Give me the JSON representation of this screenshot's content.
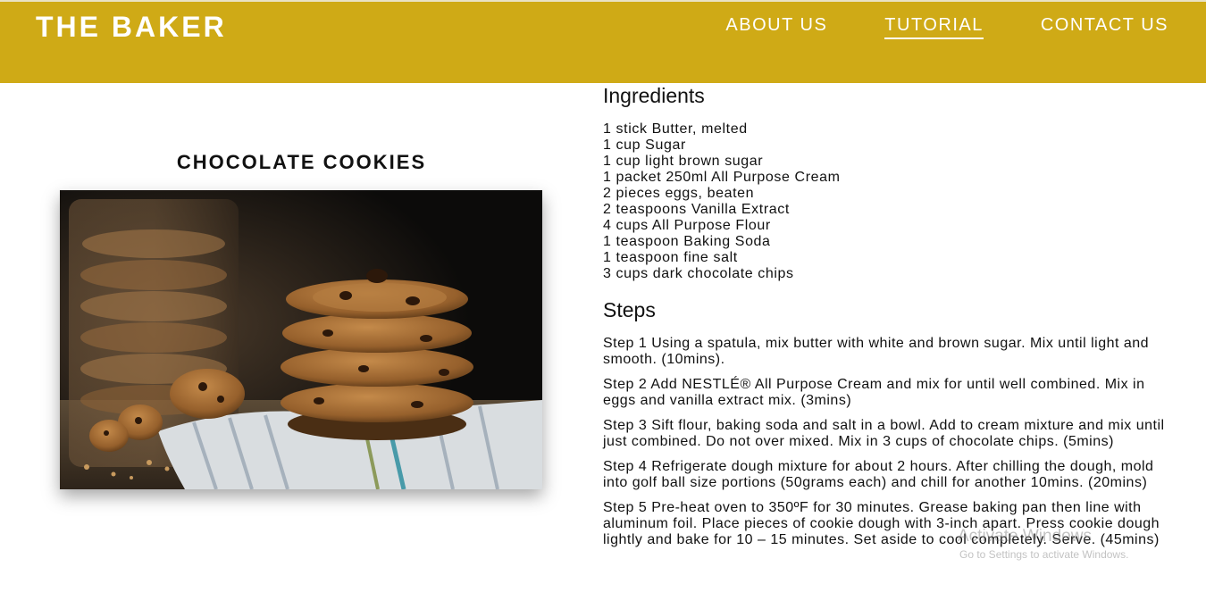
{
  "header": {
    "brand": "THE BAKER",
    "nav": [
      {
        "label": "ABOUT US",
        "active": false
      },
      {
        "label": "TUTORIAL",
        "active": true
      },
      {
        "label": "CONTACT US",
        "active": false
      }
    ],
    "bar_color": "#cfaa16"
  },
  "recipe": {
    "title": "CHOCOLATE COOKIES",
    "image_icon": "cookies-photo"
  },
  "ingredients": {
    "heading": "Ingredients",
    "items": [
      "1 stick Butter, melted",
      "1 cup Sugar",
      "1 cup light brown sugar",
      "1 packet 250ml All Purpose Cream",
      "2 pieces eggs, beaten",
      "2 teaspoons Vanilla Extract",
      "4 cups All Purpose Flour",
      "1 teaspoon Baking Soda",
      "1 teaspoon fine salt",
      "3 cups dark chocolate chips"
    ]
  },
  "steps": {
    "heading": "Steps",
    "items": [
      "Step 1 Using a spatula, mix butter with white and brown sugar. Mix until light and smooth. (10mins).",
      "Step 2 Add NESTLÉ® All Purpose Cream and mix for until well combined. Mix in eggs and vanilla extract mix. (3mins)",
      "Step 3 Sift flour, baking soda and salt in a bowl. Add to cream mixture and mix until just combined. Do not over mixed. Mix in 3 cups of chocolate chips. (5mins)",
      "Step 4 Refrigerate dough mixture for about 2 hours. After chilling the dough, mold into golf ball size portions (50grams each) and chill for another 10mins. (20mins)",
      "Step 5 Pre-heat oven to 350ºF for 30 minutes. Grease baking pan then line with aluminum foil. Place pieces of cookie dough with 3-inch apart. Press cookie dough lightly and bake for 10 – 15 minutes. Set aside to cool completely. Serve. (45mins)"
    ]
  },
  "watermark": {
    "title": "Activate Windows",
    "subtitle": "Go to Settings to activate Windows."
  }
}
